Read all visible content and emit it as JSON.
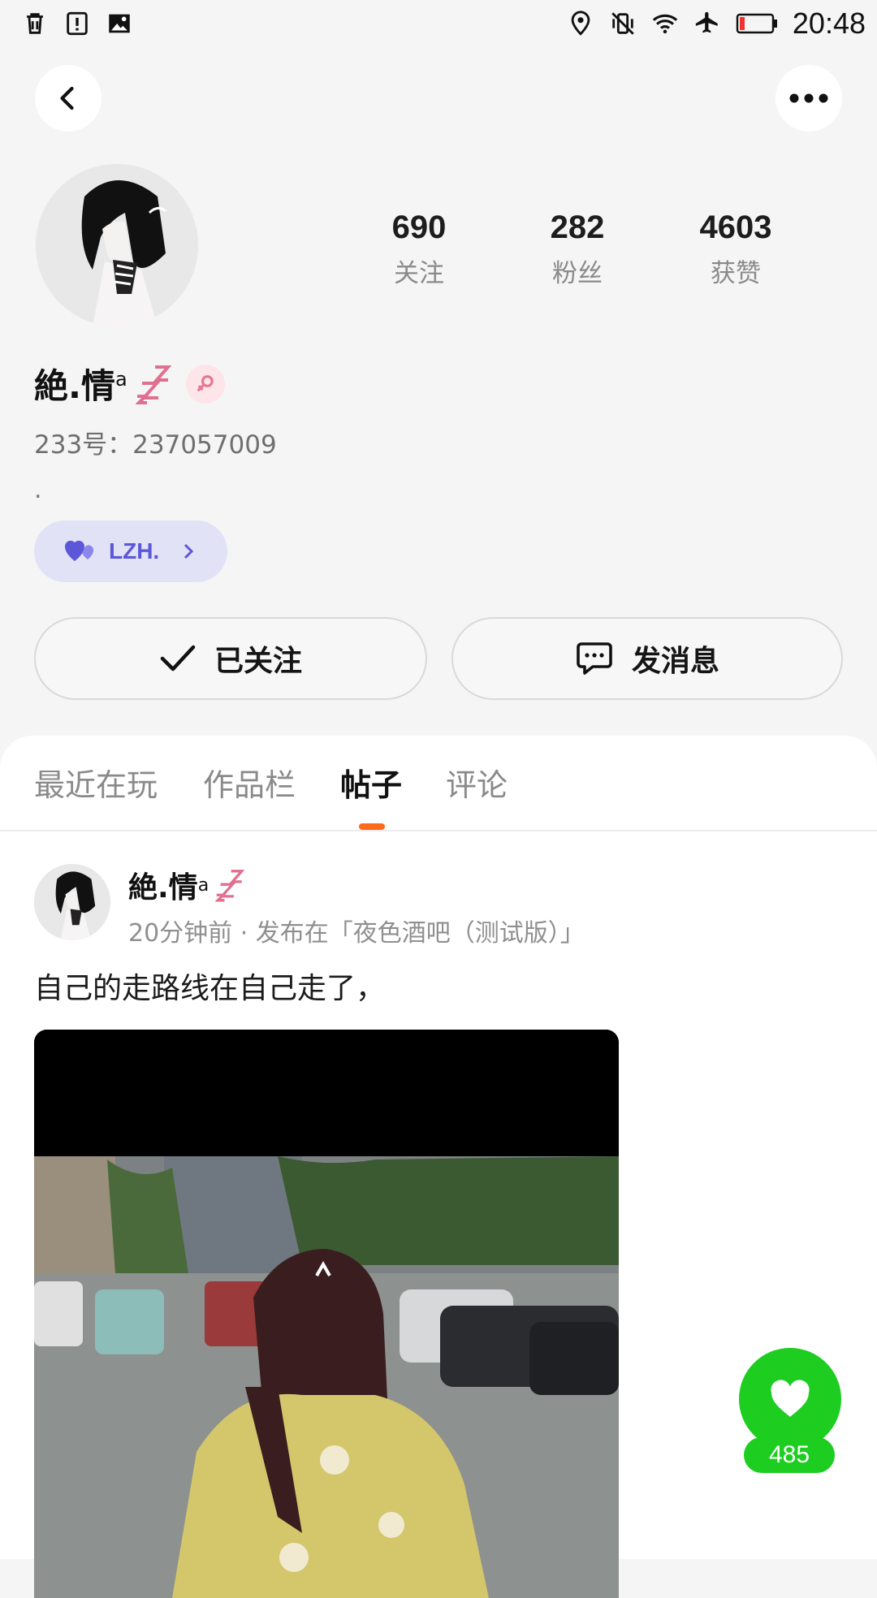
{
  "status_bar": {
    "time": "20:48",
    "left_icons": [
      "trash-icon",
      "alert-icon",
      "image-icon"
    ],
    "right_icons": [
      "location-icon",
      "vibrate-off-icon",
      "wifi-icon",
      "airplane-icon",
      "battery-icon"
    ]
  },
  "header": {
    "back_icon": "chevron-left-icon",
    "more_icon": "more-dots-icon"
  },
  "profile": {
    "stats": [
      {
        "value": "690",
        "label": "关注"
      },
      {
        "value": "282",
        "label": "粉丝"
      },
      {
        "value": "4603",
        "label": "获赞"
      }
    ],
    "name": "絶.情",
    "name_sup": "a",
    "gender_icon": "female-icon",
    "uid": "233号：237057009",
    "bio": ".",
    "tag": {
      "text": "LZH.",
      "icon": "heart-pair-icon",
      "color": "#5b57d8"
    }
  },
  "actions": {
    "follow_label": "已关注",
    "message_label": "发消息"
  },
  "tabs": {
    "items": [
      "最近在玩",
      "作品栏",
      "帖子",
      "评论"
    ],
    "active": "帖子",
    "indicator_color": "#ff6a1a"
  },
  "post": {
    "author": "絶.情",
    "author_sup": "a",
    "meta": "20分钟前 · 发布在「夜色酒吧（测试版）」",
    "text": "自己的走路线在自己走了，"
  },
  "like": {
    "count": "485",
    "color": "#1dcd1f"
  }
}
